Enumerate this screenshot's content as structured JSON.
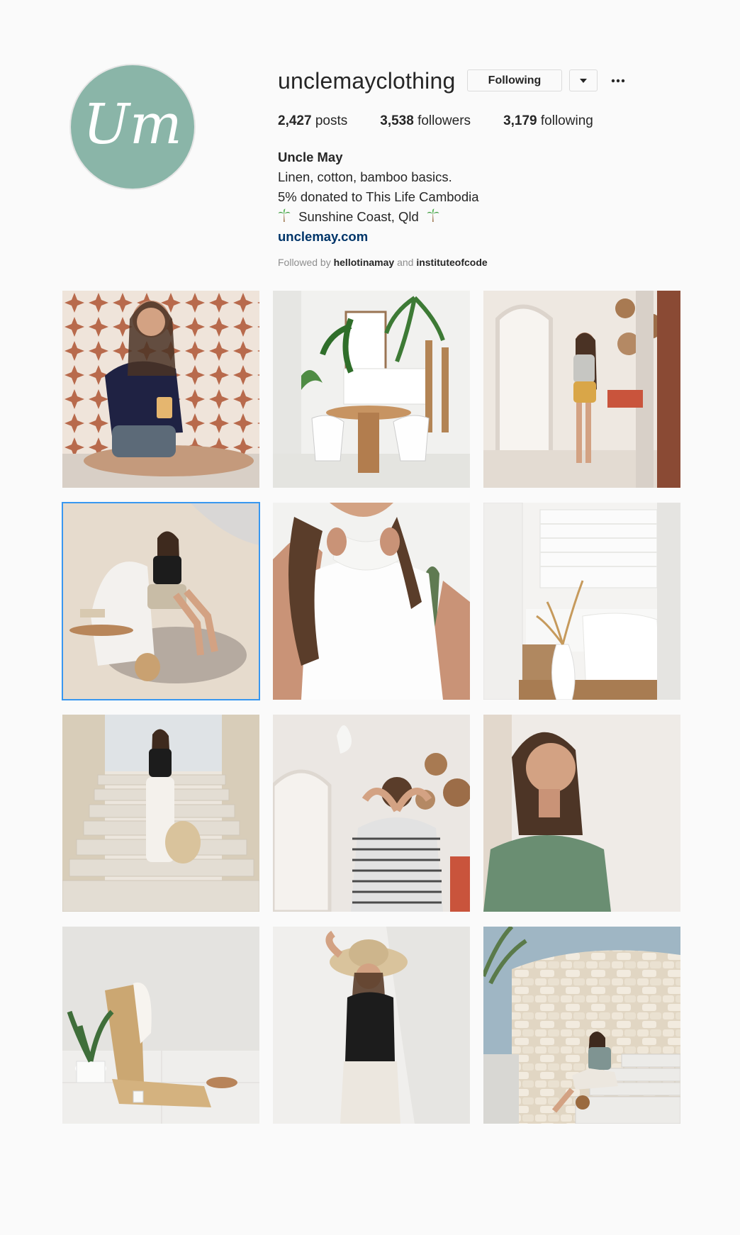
{
  "profile": {
    "username": "unclemayclothing",
    "avatar_text": "Um",
    "follow_button": "Following",
    "dropdown_icon": "chevron-down-icon",
    "more_icon": "more-dots-icon",
    "stats": {
      "posts_count": "2,427",
      "posts_label": "posts",
      "followers_count": "3,538",
      "followers_label": "followers",
      "following_count": "3,179",
      "following_label": "following"
    },
    "bio": {
      "name": "Uncle May",
      "line1": "Linen, cotton, bamboo basics.",
      "line2": "5% donated to This Life Cambodia",
      "line3": "Sunshine Coast, Qld",
      "link": "unclemay.com"
    },
    "followed_by": {
      "prefix": "Followed by",
      "user1": "hellotinamay",
      "conjunction": "and",
      "user2": "instituteofcode"
    }
  },
  "colors": {
    "avatar_bg": "#8ab5a8",
    "link": "#003569",
    "selected_outline": "#3897f0"
  },
  "posts": [
    {
      "id": 1,
      "selected": false
    },
    {
      "id": 2,
      "selected": false
    },
    {
      "id": 3,
      "selected": false
    },
    {
      "id": 4,
      "selected": true
    },
    {
      "id": 5,
      "selected": false
    },
    {
      "id": 6,
      "selected": false
    },
    {
      "id": 7,
      "selected": false
    },
    {
      "id": 8,
      "selected": false
    },
    {
      "id": 9,
      "selected": false
    },
    {
      "id": 10,
      "selected": false
    },
    {
      "id": 11,
      "selected": false
    },
    {
      "id": 12,
      "selected": false
    }
  ]
}
